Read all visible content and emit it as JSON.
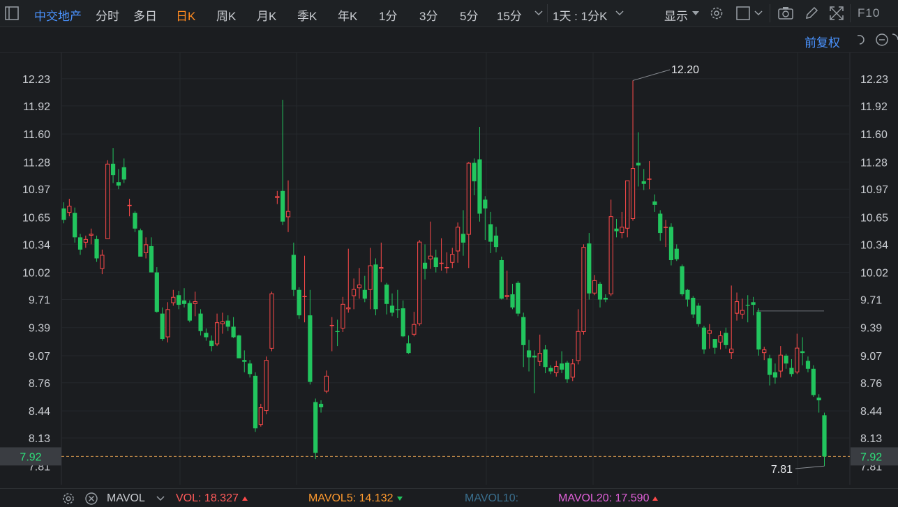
{
  "toolbar": {
    "stock_name": "中交地产",
    "periods": [
      "分时",
      "多日",
      "日K",
      "周K",
      "月K",
      "季K",
      "年K",
      "1分",
      "3分",
      "5分",
      "15分"
    ],
    "active_period": "日K",
    "interval_label": "1天 : 1分K",
    "display_label": "显示",
    "f10_label": "F10"
  },
  "adjust_label": "前复权",
  "colors": {
    "up": "#ff4a4a",
    "down": "#22c55e",
    "accent": "#ff8a1f",
    "link": "#4a93ff"
  },
  "chart_data": {
    "type": "candlestick",
    "y_ticks": [
      "12.23",
      "11.92",
      "11.60",
      "11.28",
      "10.97",
      "10.65",
      "10.34",
      "10.02",
      "9.71",
      "9.39",
      "9.07",
      "8.76",
      "8.44",
      "8.13",
      "7.81"
    ],
    "ylim": [
      7.72,
      12.4
    ],
    "current_price": "7.92",
    "high_annotation": "12.20",
    "low_annotation": "7.81",
    "ref_line_price": 9.58,
    "candles": [
      [
        10.75,
        10.62,
        10.82,
        10.58
      ],
      [
        10.7,
        10.78,
        10.86,
        10.66
      ],
      [
        10.7,
        10.42,
        10.76,
        10.36
      ],
      [
        10.42,
        10.28,
        10.46,
        10.22
      ],
      [
        10.36,
        10.4,
        10.44,
        10.3
      ],
      [
        10.44,
        10.46,
        10.52,
        10.34
      ],
      [
        10.4,
        10.18,
        10.44,
        10.14
      ],
      [
        10.06,
        10.22,
        10.28,
        10.0
      ],
      [
        10.4,
        11.26,
        11.3,
        10.4
      ],
      [
        11.26,
        11.13,
        11.44,
        11.04
      ],
      [
        11.05,
        11.01,
        11.2,
        10.97
      ],
      [
        11.22,
        11.08,
        11.32,
        11.04
      ],
      [
        10.78,
        10.79,
        10.86,
        10.66
      ],
      [
        10.7,
        10.52,
        10.72,
        10.48
      ],
      [
        10.5,
        10.2,
        10.52,
        10.2
      ],
      [
        10.24,
        10.34,
        10.42,
        10.18
      ],
      [
        10.32,
        10.02,
        10.42,
        10.02
      ],
      [
        10.02,
        9.57,
        10.08,
        9.56
      ],
      [
        9.55,
        9.26,
        9.62,
        9.24
      ],
      [
        9.28,
        9.6,
        9.68,
        9.22
      ],
      [
        9.67,
        9.74,
        9.82,
        9.64
      ],
      [
        9.76,
        9.65,
        9.81,
        9.6
      ],
      [
        9.7,
        9.66,
        9.84,
        9.62
      ],
      [
        9.67,
        9.47,
        9.7,
        9.45
      ],
      [
        9.66,
        9.69,
        9.8,
        9.52
      ],
      [
        9.55,
        9.35,
        9.6,
        9.3
      ],
      [
        9.33,
        9.28,
        9.38,
        9.24
      ],
      [
        9.24,
        9.18,
        9.3,
        9.12
      ],
      [
        9.2,
        9.45,
        9.55,
        9.18
      ],
      [
        9.43,
        9.46,
        9.56,
        9.32
      ],
      [
        9.47,
        9.4,
        9.53,
        9.35
      ],
      [
        9.4,
        9.28,
        9.51,
        9.27
      ],
      [
        9.3,
        9.04,
        9.31,
        9.04
      ],
      [
        9.02,
        9.0,
        9.13,
        8.88
      ],
      [
        8.98,
        8.86,
        9.02,
        8.82
      ],
      [
        8.84,
        8.24,
        8.88,
        8.2
      ],
      [
        8.28,
        8.48,
        8.52,
        8.26
      ],
      [
        8.44,
        9.02,
        9.06,
        8.4
      ],
      [
        9.15,
        9.78,
        9.8,
        9.12
      ],
      [
        10.87,
        10.89,
        10.95,
        10.8
      ],
      [
        10.95,
        10.6,
        11.99,
        10.56
      ],
      [
        10.65,
        10.72,
        11.07,
        10.48
      ],
      [
        10.22,
        9.82,
        10.36,
        9.75
      ],
      [
        9.82,
        9.53,
        9.85,
        9.49
      ],
      [
        9.75,
        9.75,
        10.21,
        9.45
      ],
      [
        9.53,
        8.77,
        9.82,
        8.74
      ],
      [
        8.54,
        7.96,
        8.58,
        7.89
      ],
      [
        8.52,
        8.48,
        8.56,
        8.42
      ],
      [
        8.66,
        8.84,
        8.9,
        8.64
      ],
      [
        9.42,
        9.42,
        9.51,
        9.12
      ],
      [
        9.35,
        9.34,
        9.48,
        9.18
      ],
      [
        9.38,
        9.66,
        9.74,
        9.34
      ],
      [
        9.6,
        9.62,
        10.29,
        9.56
      ],
      [
        9.75,
        9.83,
        9.95,
        9.6
      ],
      [
        9.84,
        9.88,
        10.07,
        9.72
      ],
      [
        9.82,
        9.72,
        9.98,
        9.68
      ],
      [
        9.82,
        10.1,
        10.3,
        9.6
      ],
      [
        10.11,
        9.6,
        10.18,
        9.53
      ],
      [
        10.06,
        10.08,
        10.36,
        9.91
      ],
      [
        9.88,
        9.66,
        9.9,
        9.54
      ],
      [
        9.64,
        9.56,
        9.78,
        9.52
      ],
      [
        9.6,
        9.59,
        9.82,
        9.5
      ],
      [
        9.61,
        9.29,
        9.7,
        9.28
      ],
      [
        9.21,
        9.1,
        9.3,
        9.09
      ],
      [
        9.31,
        9.43,
        9.57,
        9.29
      ],
      [
        9.43,
        10.37,
        10.39,
        9.41
      ],
      [
        10.13,
        10.06,
        10.34,
        9.94
      ],
      [
        10.17,
        10.21,
        10.6,
        10.06
      ],
      [
        10.19,
        10.08,
        10.28,
        10.02
      ],
      [
        10.12,
        10.13,
        10.41,
        10.04
      ],
      [
        10.08,
        10.08,
        10.25,
        10.01
      ],
      [
        10.13,
        10.23,
        10.3,
        10.07
      ],
      [
        10.26,
        10.54,
        10.59,
        10.13
      ],
      [
        10.46,
        10.36,
        10.73,
        10.21
      ],
      [
        10.45,
        11.27,
        11.28,
        10.07
      ],
      [
        11.27,
        11.06,
        11.32,
        10.9
      ],
      [
        11.31,
        10.69,
        11.68,
        10.6
      ],
      [
        10.85,
        10.75,
        10.89,
        10.39
      ],
      [
        10.57,
        10.37,
        10.71,
        10.24
      ],
      [
        10.44,
        10.31,
        10.54,
        10.25
      ],
      [
        10.16,
        9.72,
        10.2,
        9.71
      ],
      [
        9.74,
        9.76,
        10.04,
        9.71
      ],
      [
        9.77,
        9.62,
        9.89,
        9.6
      ],
      [
        9.9,
        9.55,
        9.92,
        9.52
      ],
      [
        9.51,
        9.19,
        9.56,
        8.94
      ],
      [
        9.13,
        9.05,
        9.25,
        8.89
      ],
      [
        9.07,
        9.05,
        9.13,
        8.64
      ],
      [
        9.0,
        9.1,
        9.31,
        8.95
      ],
      [
        9.14,
        8.94,
        9.19,
        8.87
      ],
      [
        8.93,
        8.89,
        8.96,
        8.86
      ],
      [
        8.87,
        8.95,
        9.01,
        8.83
      ],
      [
        8.98,
        8.91,
        9.12,
        8.87
      ],
      [
        8.99,
        8.8,
        9.01,
        8.76
      ],
      [
        8.82,
        8.98,
        9.03,
        8.78
      ],
      [
        9.01,
        9.35,
        9.6,
        8.97
      ],
      [
        9.34,
        10.31,
        10.34,
        9.31
      ],
      [
        10.35,
        9.78,
        10.47,
        9.71
      ],
      [
        9.78,
        9.93,
        9.99,
        9.76
      ],
      [
        9.89,
        9.71,
        9.91,
        9.62
      ],
      [
        9.73,
        9.71,
        9.77,
        9.68
      ],
      [
        9.77,
        10.66,
        10.85,
        9.75
      ],
      [
        10.52,
        10.49,
        10.63,
        10.42
      ],
      [
        10.47,
        10.54,
        10.71,
        10.41
      ],
      [
        10.52,
        11.07,
        10.75,
        10.42
      ],
      [
        10.63,
        11.21,
        12.21,
        10.61
      ],
      [
        11.27,
        11.24,
        11.62,
        11.0
      ],
      [
        11.06,
        11.03,
        11.2,
        10.96
      ],
      [
        11.08,
        11.09,
        11.29,
        10.97
      ],
      [
        10.83,
        10.79,
        10.91,
        10.71
      ],
      [
        10.69,
        10.47,
        10.73,
        10.38
      ],
      [
        10.54,
        10.54,
        10.62,
        10.31
      ],
      [
        10.54,
        10.16,
        10.58,
        10.1
      ],
      [
        10.29,
        10.17,
        10.34,
        10.15
      ],
      [
        10.09,
        9.77,
        10.11,
        9.75
      ],
      [
        9.82,
        9.71,
        9.83,
        9.63
      ],
      [
        9.73,
        9.54,
        9.75,
        9.5
      ],
      [
        9.64,
        9.43,
        9.67,
        9.4
      ],
      [
        9.39,
        9.14,
        9.41,
        9.09
      ],
      [
        9.32,
        9.36,
        9.43,
        9.15
      ],
      [
        9.26,
        9.16,
        9.26,
        9.09
      ],
      [
        9.22,
        9.3,
        9.35,
        9.14
      ],
      [
        9.33,
        9.19,
        9.39,
        9.15
      ],
      [
        9.1,
        9.15,
        9.87,
        9.03
      ],
      [
        9.55,
        9.69,
        9.79,
        9.47
      ],
      [
        9.54,
        9.59,
        9.72,
        9.49
      ],
      [
        9.65,
        9.64,
        9.76,
        9.45
      ],
      [
        9.68,
        9.65,
        9.74,
        9.53
      ],
      [
        9.57,
        9.14,
        9.61,
        9.07
      ],
      [
        9.1,
        9.14,
        9.17,
        9.02
      ],
      [
        9.04,
        8.85,
        9.08,
        8.73
      ],
      [
        8.88,
        8.82,
        8.98,
        8.75
      ],
      [
        8.89,
        9.08,
        9.18,
        8.82
      ],
      [
        9.07,
        8.98,
        9.09,
        8.92
      ],
      [
        8.93,
        8.86,
        9.03,
        8.83
      ],
      [
        8.88,
        9.16,
        9.32,
        8.86
      ],
      [
        9.12,
        9.1,
        9.28,
        8.96
      ],
      [
        9.01,
        8.92,
        9.06,
        8.88
      ],
      [
        8.92,
        8.62,
        8.96,
        8.6
      ],
      [
        8.59,
        8.56,
        8.63,
        8.42
      ],
      [
        8.39,
        7.92,
        8.42,
        7.81
      ]
    ]
  },
  "bottom": {
    "indicator_name": "MAVOL",
    "vol_label": "VOL:",
    "vol_value": "18.327",
    "ma5_label": "MAVOL5:",
    "ma5_value": "14.132",
    "ma10_label": "MAVOL10:",
    "ma20_label": "MAVOL20:",
    "ma20_value": "17.590"
  }
}
